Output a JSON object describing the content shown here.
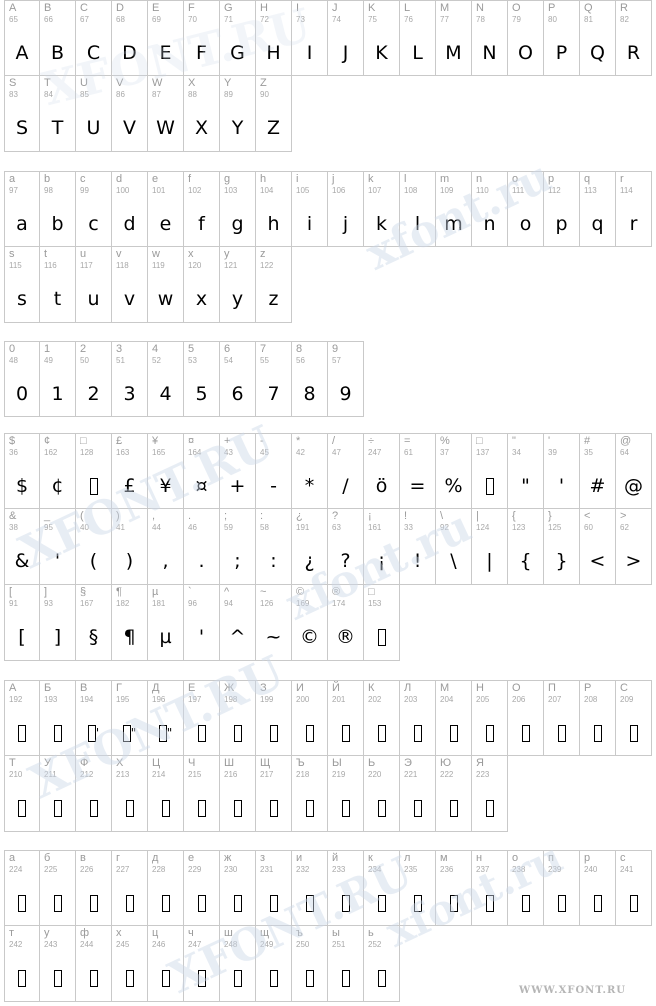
{
  "watermark_text": "XFONT.RU",
  "watermark_small": "xfont.ru",
  "footer_text": "WWW.XFONT.RU",
  "sections": [
    {
      "rows": [
        [
          [
            "A",
            "65",
            "A"
          ],
          [
            "B",
            "66",
            "B"
          ],
          [
            "C",
            "67",
            "C"
          ],
          [
            "D",
            "68",
            "D"
          ],
          [
            "E",
            "69",
            "E"
          ],
          [
            "F",
            "70",
            "F"
          ],
          [
            "G",
            "71",
            "G"
          ],
          [
            "H",
            "72",
            "H"
          ],
          [
            "I",
            "73",
            "I"
          ],
          [
            "J",
            "74",
            "J"
          ],
          [
            "K",
            "75",
            "K"
          ],
          [
            "L",
            "76",
            "L"
          ],
          [
            "M",
            "77",
            "M"
          ],
          [
            "N",
            "78",
            "N"
          ],
          [
            "O",
            "79",
            "O"
          ],
          [
            "P",
            "80",
            "P"
          ],
          [
            "Q",
            "81",
            "Q"
          ],
          [
            "R",
            "82",
            "R"
          ]
        ],
        [
          [
            "S",
            "83",
            "S"
          ],
          [
            "T",
            "84",
            "T"
          ],
          [
            "U",
            "85",
            "U"
          ],
          [
            "V",
            "86",
            "V"
          ],
          [
            "W",
            "87",
            "W"
          ],
          [
            "X",
            "88",
            "X"
          ],
          [
            "Y",
            "89",
            "Y"
          ],
          [
            "Z",
            "90",
            "Z"
          ]
        ]
      ]
    },
    {
      "rows": [
        [
          [
            "a",
            "97",
            "a"
          ],
          [
            "b",
            "98",
            "b"
          ],
          [
            "c",
            "99",
            "c"
          ],
          [
            "d",
            "100",
            "d"
          ],
          [
            "e",
            "101",
            "e"
          ],
          [
            "f",
            "102",
            "f"
          ],
          [
            "g",
            "103",
            "g"
          ],
          [
            "h",
            "104",
            "h"
          ],
          [
            "i",
            "105",
            "i"
          ],
          [
            "j",
            "106",
            "j"
          ],
          [
            "k",
            "107",
            "k"
          ],
          [
            "l",
            "108",
            "l"
          ],
          [
            "m",
            "109",
            "m"
          ],
          [
            "n",
            "110",
            "n"
          ],
          [
            "o",
            "111",
            "o"
          ],
          [
            "p",
            "112",
            "p"
          ],
          [
            "q",
            "113",
            "q"
          ],
          [
            "r",
            "114",
            "r"
          ]
        ],
        [
          [
            "s",
            "115",
            "s"
          ],
          [
            "t",
            "116",
            "t"
          ],
          [
            "u",
            "117",
            "u"
          ],
          [
            "v",
            "118",
            "v"
          ],
          [
            "w",
            "119",
            "w"
          ],
          [
            "x",
            "120",
            "x"
          ],
          [
            "y",
            "121",
            "y"
          ],
          [
            "z",
            "122",
            "z"
          ]
        ]
      ]
    },
    {
      "rows": [
        [
          [
            "0",
            "48",
            "0"
          ],
          [
            "1",
            "49",
            "1"
          ],
          [
            "2",
            "50",
            "2"
          ],
          [
            "3",
            "51",
            "3"
          ],
          [
            "4",
            "52",
            "4"
          ],
          [
            "5",
            "53",
            "5"
          ],
          [
            "6",
            "54",
            "6"
          ],
          [
            "7",
            "55",
            "7"
          ],
          [
            "8",
            "56",
            "8"
          ],
          [
            "9",
            "57",
            "9"
          ]
        ]
      ]
    },
    {
      "rows": [
        [
          [
            "$",
            "36",
            "$"
          ],
          [
            "¢",
            "162",
            "¢"
          ],
          [
            "□",
            "128",
            "■"
          ],
          [
            "£",
            "163",
            "£"
          ],
          [
            "¥",
            "165",
            "¥"
          ],
          [
            "¤",
            "164",
            "¤"
          ],
          [
            "+",
            "43",
            "+"
          ],
          [
            "-",
            "45",
            "-"
          ],
          [
            "*",
            "42",
            "*"
          ],
          [
            "/",
            "47",
            "/"
          ],
          [
            "÷",
            "247",
            "ö"
          ],
          [
            "=",
            "61",
            "="
          ],
          [
            "%",
            "37",
            "%"
          ],
          [
            "□",
            "137",
            "■"
          ],
          [
            "\"",
            "34",
            "\""
          ],
          [
            "'",
            "39",
            "'"
          ],
          [
            "#",
            "35",
            "#"
          ],
          [
            "@",
            "64",
            "@"
          ]
        ],
        [
          [
            "&",
            "38",
            "&"
          ],
          [
            "_",
            "95",
            "'"
          ],
          [
            "(",
            "40",
            "("
          ],
          [
            ")",
            "41",
            ")"
          ],
          [
            ",",
            "44",
            ","
          ],
          [
            ".",
            "46",
            "."
          ],
          [
            ";",
            "59",
            ";"
          ],
          [
            ":",
            "58",
            ":"
          ],
          [
            "¿",
            "191",
            "¿"
          ],
          [
            "?",
            "63",
            "?"
          ],
          [
            "¡",
            "161",
            "¡"
          ],
          [
            "!",
            "33",
            "!"
          ],
          [
            "\\",
            "92",
            "\\"
          ],
          [
            "|",
            "124",
            "|"
          ],
          [
            "{",
            "123",
            "{"
          ],
          [
            "}",
            "125",
            "}"
          ],
          [
            "<",
            "60",
            "<"
          ],
          [
            ">",
            "62",
            ">"
          ]
        ],
        [
          [
            "[",
            "91",
            "["
          ],
          [
            "]",
            "93",
            "]"
          ],
          [
            "§",
            "167",
            "§"
          ],
          [
            "¶",
            "182",
            "¶"
          ],
          [
            "µ",
            "181",
            "µ"
          ],
          [
            "`",
            "96",
            "'"
          ],
          [
            "^",
            "94",
            "^"
          ],
          [
            "~",
            "126",
            "~"
          ],
          [
            "©",
            "169",
            "©"
          ],
          [
            "®",
            "174",
            "®"
          ],
          [
            "□",
            "153",
            "■"
          ]
        ]
      ]
    },
    {
      "rows": [
        [
          [
            "А",
            "192",
            "■"
          ],
          [
            "Б",
            "193",
            "■"
          ],
          [
            "В",
            "194",
            "■'"
          ],
          [
            "Г",
            "195",
            "■\""
          ],
          [
            "Д",
            "196",
            "■\""
          ],
          [
            "Е",
            "197",
            "■"
          ],
          [
            "Ж",
            "198",
            "■"
          ],
          [
            "З",
            "199",
            "■"
          ],
          [
            "И",
            "200",
            "■"
          ],
          [
            "Й",
            "201",
            "■"
          ],
          [
            "К",
            "202",
            "■"
          ],
          [
            "Л",
            "203",
            "■"
          ],
          [
            "М",
            "204",
            "■"
          ],
          [
            "Н",
            "205",
            "■"
          ],
          [
            "О",
            "206",
            "■"
          ],
          [
            "П",
            "207",
            "■"
          ],
          [
            "Р",
            "208",
            "■"
          ],
          [
            "С",
            "209",
            "■"
          ]
        ],
        [
          [
            "Т",
            "210",
            "■"
          ],
          [
            "У",
            "211",
            "■"
          ],
          [
            "Ф",
            "212",
            "■"
          ],
          [
            "Х",
            "213",
            "■"
          ],
          [
            "Ц",
            "214",
            "■"
          ],
          [
            "Ч",
            "215",
            "■"
          ],
          [
            "Ш",
            "216",
            "■"
          ],
          [
            "Щ",
            "217",
            "■"
          ],
          [
            "Ъ",
            "218",
            "■"
          ],
          [
            "Ы",
            "219",
            "■"
          ],
          [
            "Ь",
            "220",
            "■"
          ],
          [
            "Э",
            "221",
            "■"
          ],
          [
            "Ю",
            "222",
            "■"
          ],
          [
            "Я",
            "223",
            "■"
          ]
        ]
      ]
    },
    {
      "rows": [
        [
          [
            "а",
            "224",
            "■"
          ],
          [
            "б",
            "225",
            "■"
          ],
          [
            "в",
            "226",
            "■"
          ],
          [
            "г",
            "227",
            "■"
          ],
          [
            "д",
            "228",
            "■"
          ],
          [
            "е",
            "229",
            "■"
          ],
          [
            "ж",
            "230",
            "■"
          ],
          [
            "з",
            "231",
            "■"
          ],
          [
            "и",
            "232",
            "■"
          ],
          [
            "й",
            "233",
            "■"
          ],
          [
            "к",
            "234",
            "■"
          ],
          [
            "л",
            "235",
            "■"
          ],
          [
            "м",
            "236",
            "■"
          ],
          [
            "н",
            "237",
            "■"
          ],
          [
            "о",
            "238",
            "■"
          ],
          [
            "п",
            "239",
            "■"
          ],
          [
            "р",
            "240",
            "■"
          ],
          [
            "с",
            "241",
            "■"
          ]
        ],
        [
          [
            "т",
            "242",
            "■"
          ],
          [
            "у",
            "243",
            "■"
          ],
          [
            "ф",
            "244",
            "■"
          ],
          [
            "х",
            "245",
            "■"
          ],
          [
            "ц",
            "246",
            "■"
          ],
          [
            "ч",
            "247",
            "■"
          ],
          [
            "ш",
            "248",
            "■"
          ],
          [
            "щ",
            "249",
            "■"
          ],
          [
            "ъ",
            "250",
            "■"
          ],
          [
            "ы",
            "251",
            "■"
          ],
          [
            "ь",
            "252",
            "■"
          ]
        ]
      ]
    }
  ]
}
